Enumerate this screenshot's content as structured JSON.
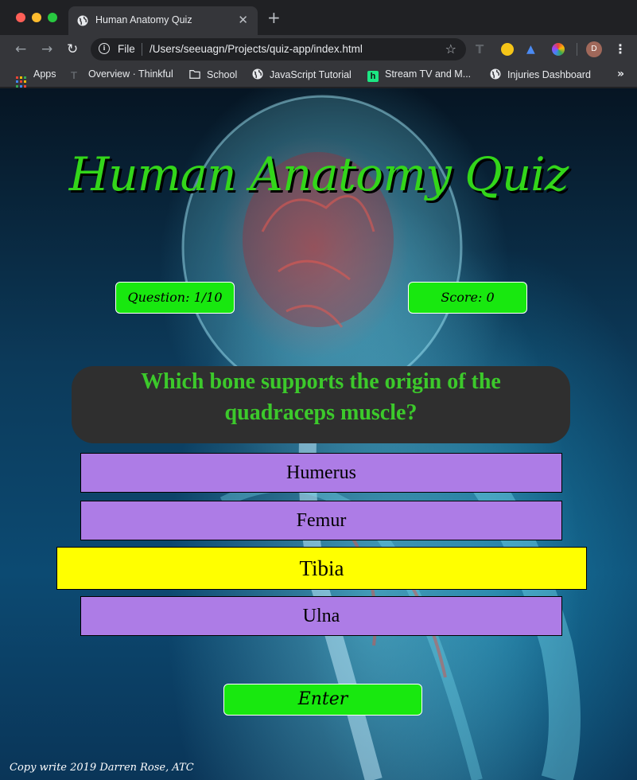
{
  "browser": {
    "tab_title": "Human Anatomy Quiz",
    "tab_close": "✕",
    "new_tab": "+",
    "back_icon": "←",
    "forward_icon": "→",
    "reload_icon": "↻",
    "scheme_label": "File",
    "url": "/Users/seeuagn/Projects/quiz-app/index.html",
    "star_icon": "☆",
    "profile_initial": "D",
    "menu_icon": "⋮"
  },
  "bookmarks": {
    "items": [
      {
        "label": "Apps",
        "icon": "apps-grid-icon"
      },
      {
        "label": "Overview · Thinkful",
        "icon": "thinkful-icon"
      },
      {
        "label": "School",
        "icon": "folder-icon"
      },
      {
        "label": "JavaScript Tutorial",
        "icon": "globe-icon"
      },
      {
        "label": "Stream TV and M...",
        "icon": "hulu-icon"
      },
      {
        "label": "Injuries Dashboard",
        "icon": "globe-icon"
      }
    ],
    "overflow": "»"
  },
  "quiz": {
    "title": "Human Anatomy Quiz",
    "question_counter": "Question: 1/10",
    "score": "Score: 0",
    "question": "Which bone supports the origin of the quadraceps muscle?",
    "answers": [
      "Humerus",
      "Femur",
      "Tibia",
      "Ulna"
    ],
    "selected_answer": "Tibia",
    "enter_label": "Enter",
    "footer": "Copy write 2019 Darren Rose, ATC"
  },
  "colors": {
    "accent_green": "#18e80f",
    "title_green": "#33d61a",
    "answer_purple": "#ad7ce6",
    "selected_yellow": "#ffff00"
  }
}
